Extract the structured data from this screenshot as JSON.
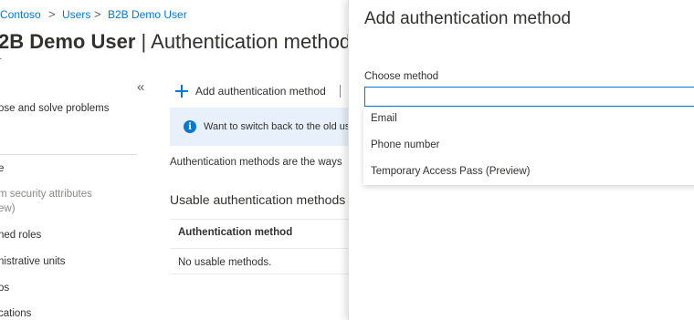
{
  "breadcrumb": {
    "items": [
      "Contoso",
      "Users",
      "B2B Demo User"
    ],
    "separator": ">"
  },
  "page": {
    "title_user": "2B Demo User",
    "title_sep": "|",
    "title_section": "Authentication methods",
    "subtitle": "r"
  },
  "nav": {
    "collapse_glyph": "«",
    "items": [
      "ose and solve problems",
      "e",
      "m security attributes",
      "ew)",
      "ned roles",
      "nistrative units",
      "os",
      "cations"
    ]
  },
  "commandbar": {
    "add_label": "Add authentication method"
  },
  "banner": {
    "text": "Want to switch back to the old us"
  },
  "content": {
    "description": "Authentication methods are the ways",
    "usable_title": "Usable authentication methods",
    "table_header": "Authentication method",
    "empty_text": "No usable methods."
  },
  "panel": {
    "title": "Add authentication method",
    "field_label": "Choose method",
    "value": "",
    "options": [
      "Email",
      "Phone number",
      "Temporary Access Pass (Preview)"
    ]
  },
  "colors": {
    "accent": "#0078d4",
    "banner_bg": "#e8f1fb",
    "text": "#323130"
  }
}
